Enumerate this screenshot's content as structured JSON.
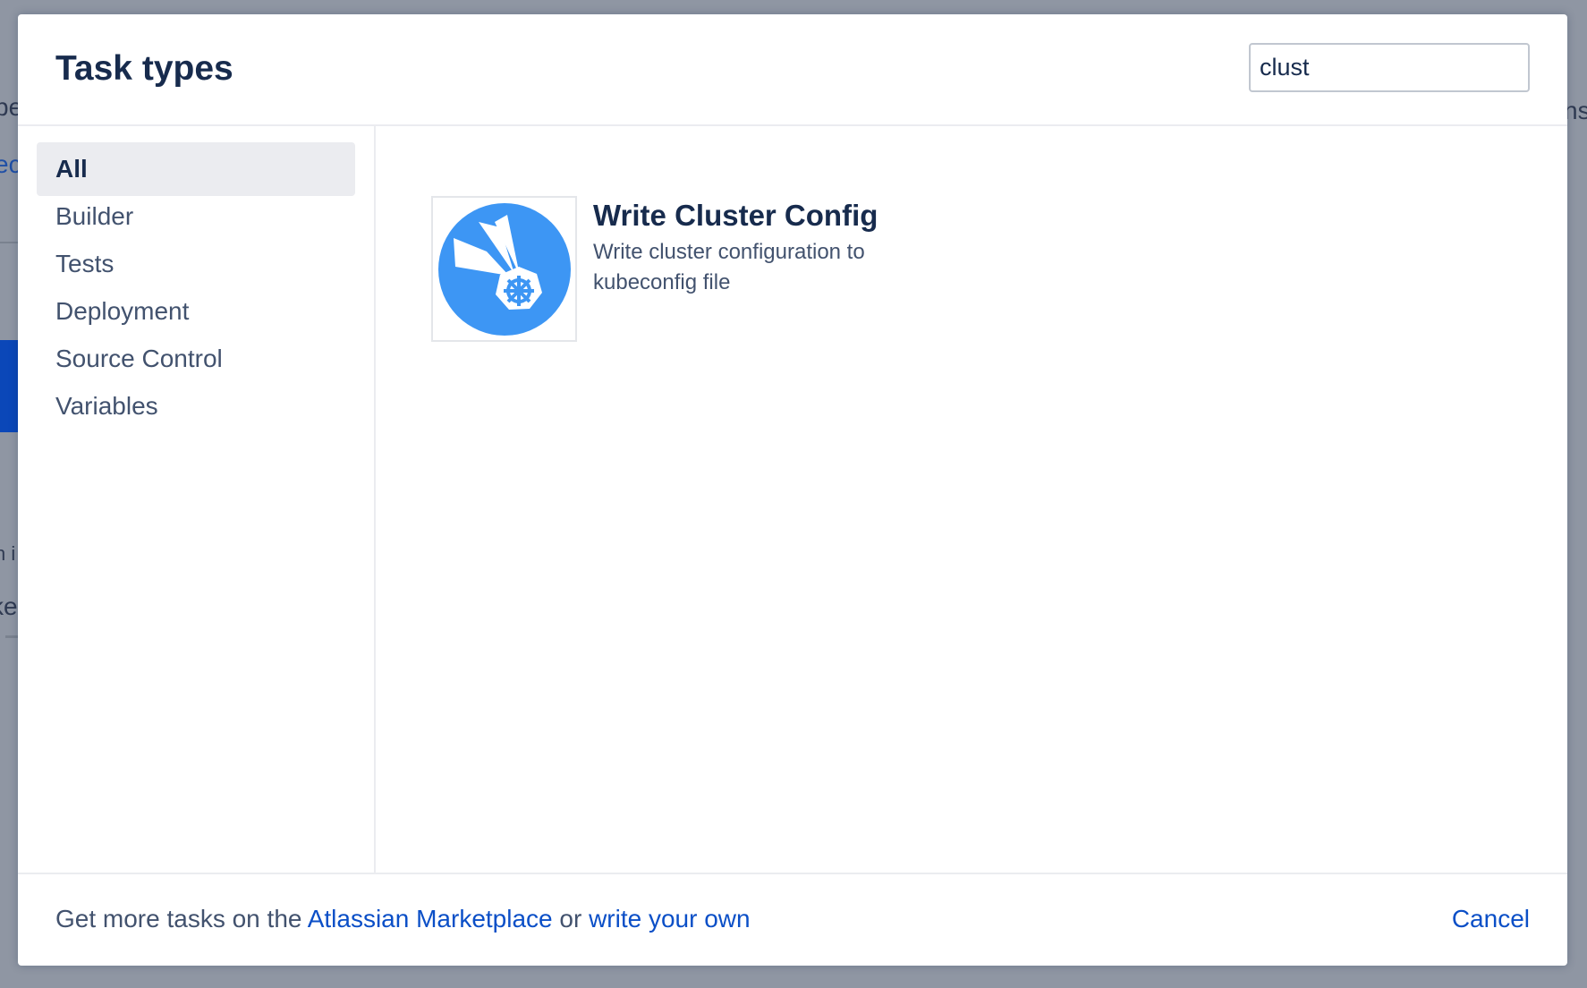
{
  "background": {
    "fragments": [
      "be",
      "ec",
      "n i",
      "ke",
      "ns"
    ]
  },
  "modal": {
    "title": "Task types",
    "search": {
      "value": "clust",
      "placeholder": ""
    }
  },
  "sidebar": {
    "items": [
      {
        "label": "All",
        "active": true
      },
      {
        "label": "Builder"
      },
      {
        "label": "Tests"
      },
      {
        "label": "Deployment"
      },
      {
        "label": "Source Control"
      },
      {
        "label": "Variables"
      }
    ]
  },
  "results": [
    {
      "title": "Write Cluster Config",
      "description": "Write cluster configuration to kubeconfig file",
      "icon": "kubernetes-helm-icon"
    }
  ],
  "footer": {
    "prefix": "Get more tasks on the ",
    "marketplace_link": "Atlassian Marketplace",
    "middle": " or ",
    "write_link": "write your own",
    "cancel": "Cancel"
  },
  "colors": {
    "accent": "#0b4fc7",
    "icon_circle": "#3d96f4",
    "title": "#172b4d",
    "text": "#42526e",
    "active_bg": "#ebecf0"
  }
}
